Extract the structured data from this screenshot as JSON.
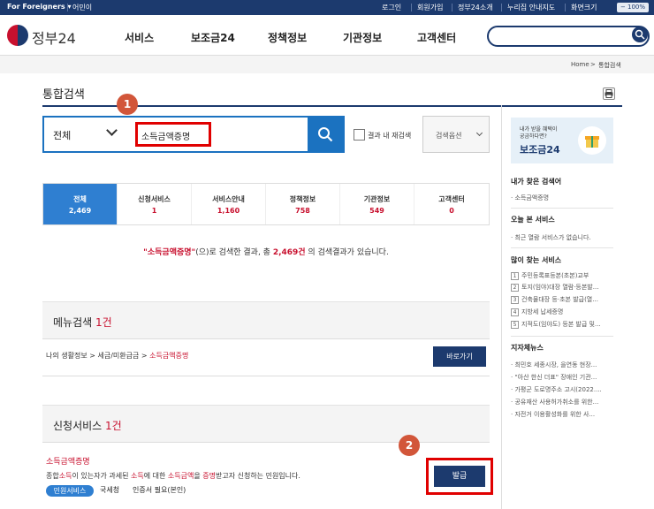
{
  "topbar": {
    "lang": "For Foreigners ▾",
    "lang2": "어민이",
    "links": [
      "로그인",
      "회원가입",
      "정부24소개",
      "누리집 안내지도",
      "화면크기"
    ],
    "zoom": "− 100% +"
  },
  "header": {
    "logo": "정부24",
    "nav": [
      "서비스",
      "보조금24",
      "정책정보",
      "기관정보",
      "고객센터"
    ],
    "search_value": ""
  },
  "breadcrumb": [
    "Home",
    "통합검색"
  ],
  "page_title": "통합검색",
  "search": {
    "scope": "전체",
    "query": "소득금액증명",
    "checkbox_label": "결과 내 재검색",
    "option_label": "검색옵션"
  },
  "badges": [
    "1",
    "2"
  ],
  "tabs": [
    {
      "label": "전체",
      "count": "2,469"
    },
    {
      "label": "신청서비스",
      "count": "1"
    },
    {
      "label": "서비스안내",
      "count": "1,160"
    },
    {
      "label": "정책정보",
      "count": "758"
    },
    {
      "label": "기관정보",
      "count": "549"
    },
    {
      "label": "고객센터",
      "count": "0"
    }
  ],
  "result": {
    "query_quoted": "\"소득금액증명\"",
    "mid": "(으)로 검색한 결과, 총 ",
    "total": "2,469건",
    "tail": " 의 검색결과가 있습니다."
  },
  "menu_section": {
    "title": "메뉴검색",
    "count": "1건",
    "path_prefix": "나의 생활정보 > 세금/미환급금 > ",
    "path_highlight": "소득금액증명",
    "button": "바로가기"
  },
  "service_section": {
    "title": "신청서비스",
    "count": "1건",
    "item_title": "소득금액증명",
    "desc_1": "종합",
    "desc_2": "소득",
    "desc_3": "이 있는자가 과세된 ",
    "desc_4": "소득",
    "desc_5": "에 대한 ",
    "desc_6": "소득금액",
    "desc_7": "을 ",
    "desc_8": "증명",
    "desc_9": "받고자 신청하는 민원입니다.",
    "tag_blue": "민원서비스",
    "tag_2": "국세청",
    "tag_3": "인증서 필요(본인)",
    "apply_button": "발급"
  },
  "sidebar": {
    "promo_l1": "내가 받을 혜택이",
    "promo_l2": "궁금하다면?",
    "promo_l3": "보조금24",
    "my_search_title": "내가 찾은 검색어",
    "my_search_items": [
      "· 소득금액증명"
    ],
    "today_title": "오늘 본 서비스",
    "today_items": [
      "· 최근 열람 서비스가 없습니다."
    ],
    "popular_title": "많이 찾는 서비스",
    "popular_items": [
      "주민등록표등본(초본)교부",
      "토지(임야)대장 열람·등본발...",
      "건축물대장 등·초본 발급(열...",
      "지방세 납세증명",
      "지적도(임야도) 등본 발급 및..."
    ],
    "news_title": "지자체뉴스",
    "news_items": [
      "· 최민호 세종시장, 을연동 현장...",
      "· \"아산 한신 더표\" 장애인 기관...",
      "· 가평군 도로명주소 고시(2022....",
      "· 공유재산 사용허가취소를 위한...",
      "· 자전거 이용활성화를 위한 사..."
    ]
  },
  "colors": {
    "navy": "#1c3a6e",
    "blue": "#1b72c0",
    "red_box": "#e00000",
    "badge": "#d2563a",
    "highlight": "#c8102e"
  }
}
